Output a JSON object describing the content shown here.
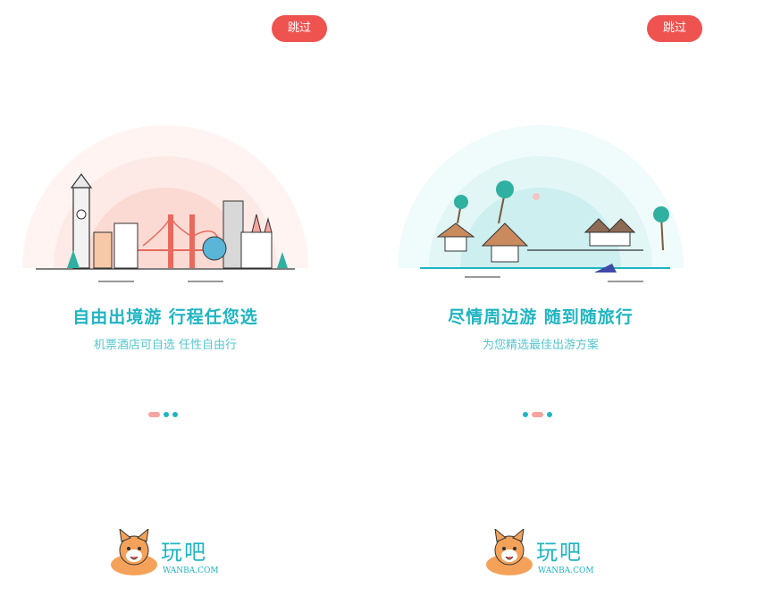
{
  "pages": [
    {
      "skip_label": "跳过",
      "headline": "自由出境游 行程任您选",
      "subline": "机票酒店可自选 任性自由行",
      "theme_color": "#fbe3df",
      "active_dot": 0
    },
    {
      "skip_label": "跳过",
      "headline": "尽情周边游 随到随旅行",
      "subline": "为您精选最佳出游方案",
      "theme_color": "#dff5f5",
      "active_dot": 1
    }
  ],
  "logo": {
    "name": "玩吧",
    "subtitle": "WANBA.COM",
    "icon": "corgi-mascot-icon"
  },
  "colors": {
    "accent": "#1fb5c2",
    "skip_button": "#ef5350",
    "dot_active": "#f5a59e"
  }
}
